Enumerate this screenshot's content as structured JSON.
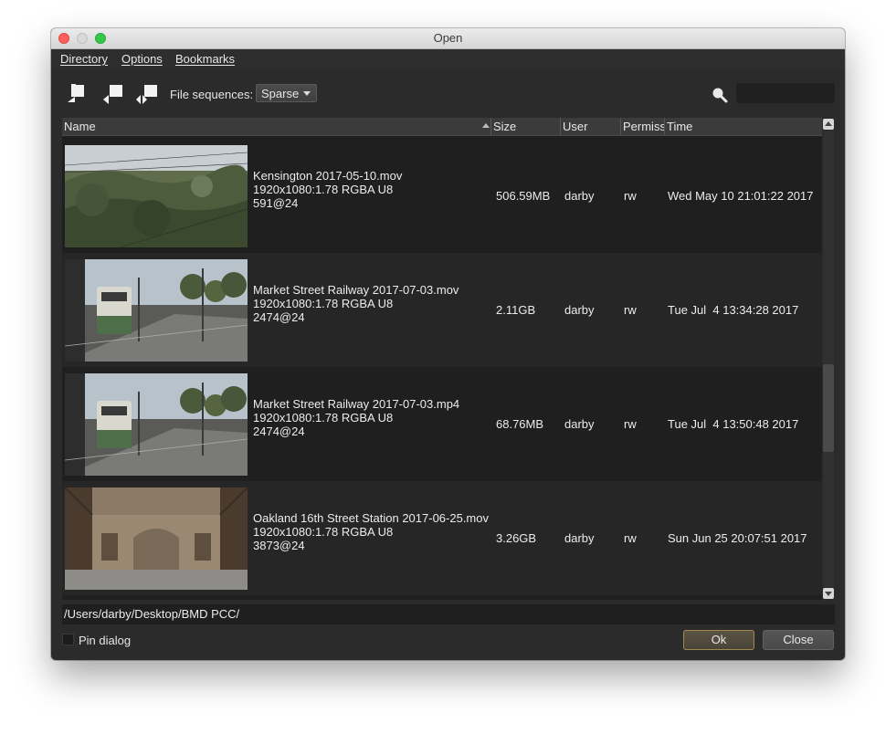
{
  "window": {
    "title": "Open"
  },
  "menubar": {
    "items": [
      "Directory",
      "Options",
      "Bookmarks"
    ]
  },
  "toolbar": {
    "sequences_label": "File sequences:",
    "sequences_value": "Sparse",
    "search_value": ""
  },
  "table": {
    "columns": [
      "Name",
      "Size",
      "User",
      "Permiss",
      "Time"
    ],
    "rows": [
      {
        "name": "Kensington 2017-05-10.mov",
        "format": "1920x1080:1.78 RGBA U8",
        "frames": "591@24",
        "size": "506.59MB",
        "user": "darby",
        "perms": "rw",
        "time": "Wed May 10 21:01:22 2017"
      },
      {
        "name": "Market Street Railway 2017-07-03.mov",
        "format": "1920x1080:1.78 RGBA U8",
        "frames": "2474@24",
        "size": "2.11GB",
        "user": "darby",
        "perms": "rw",
        "time": "Tue Jul  4 13:34:28 2017"
      },
      {
        "name": "Market Street Railway 2017-07-03.mp4",
        "format": "1920x1080:1.78 RGBA U8",
        "frames": "2474@24",
        "size": "68.76MB",
        "user": "darby",
        "perms": "rw",
        "time": "Tue Jul  4 13:50:48 2017"
      },
      {
        "name": "Oakland 16th Street Station 2017-06-25.mov",
        "format": "1920x1080:1.78 RGBA U8",
        "frames": "3873@24",
        "size": "3.26GB",
        "user": "darby",
        "perms": "rw",
        "time": "Sun Jun 25 20:07:51 2017"
      }
    ]
  },
  "footer": {
    "path": "/Users/darby/Desktop/BMD PCC/",
    "pin_label": "Pin dialog",
    "ok_label": "Ok",
    "close_label": "Close"
  }
}
